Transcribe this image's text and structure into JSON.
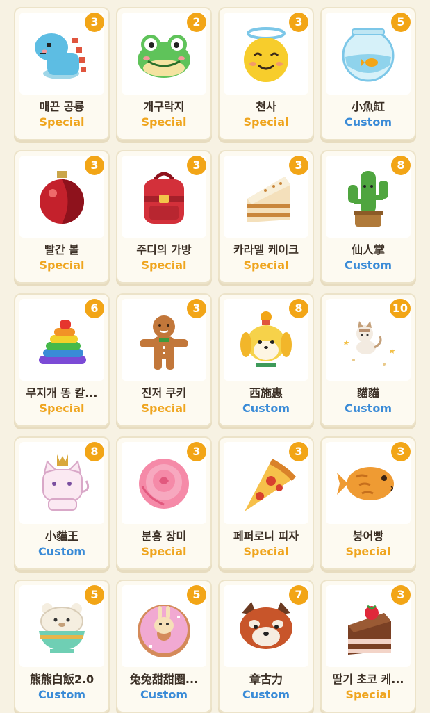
{
  "colors": {
    "special": "#efa51f",
    "custom": "#3a8bd7",
    "badge": "#f2a516"
  },
  "items": [
    {
      "name": "매끈 공룡",
      "tag": "Special",
      "count": "3",
      "icon": "dinosaur-icon"
    },
    {
      "name": "개구락지",
      "tag": "Special",
      "count": "2",
      "icon": "frog-icon"
    },
    {
      "name": "천사",
      "tag": "Special",
      "count": "3",
      "icon": "angel-face-icon"
    },
    {
      "name": "小魚缸",
      "tag": "Custom",
      "count": "5",
      "icon": "fishbowl-icon"
    },
    {
      "name": "빨간 볼",
      "tag": "Special",
      "count": "3",
      "icon": "red-ornament-icon"
    },
    {
      "name": "주디의 가방",
      "tag": "Special",
      "count": "3",
      "icon": "red-backpack-icon"
    },
    {
      "name": "카라멜 케이크",
      "tag": "Special",
      "count": "3",
      "icon": "caramel-cake-icon"
    },
    {
      "name": "仙人掌",
      "tag": "Custom",
      "count": "8",
      "icon": "cactus-icon"
    },
    {
      "name": "무지개 똥 칼...",
      "tag": "Special",
      "count": "6",
      "icon": "rainbow-poop-icon"
    },
    {
      "name": "진저 쿠키",
      "tag": "Special",
      "count": "3",
      "icon": "gingerbread-icon"
    },
    {
      "name": "西施惠",
      "tag": "Custom",
      "count": "8",
      "icon": "isabelle-icon"
    },
    {
      "name": "貓貓",
      "tag": "Custom",
      "count": "10",
      "icon": "cat-icon"
    },
    {
      "name": "小貓王",
      "tag": "Custom",
      "count": "8",
      "icon": "cat-king-icon"
    },
    {
      "name": "분홍 장미",
      "tag": "Special",
      "count": "3",
      "icon": "pink-rose-icon"
    },
    {
      "name": "페퍼로니 피자",
      "tag": "Special",
      "count": "3",
      "icon": "pizza-icon"
    },
    {
      "name": "붕어빵",
      "tag": "Special",
      "count": "3",
      "icon": "taiyaki-icon"
    },
    {
      "name": "熊熊白飯2.0",
      "tag": "Custom",
      "count": "5",
      "icon": "bear-rice-bowl-icon"
    },
    {
      "name": "兔兔甜甜圈...",
      "tag": "Custom",
      "count": "5",
      "icon": "bunny-donut-icon"
    },
    {
      "name": "章古力",
      "tag": "Custom",
      "count": "7",
      "icon": "red-panda-icon"
    },
    {
      "name": "딸기 초코 케...",
      "tag": "Special",
      "count": "3",
      "icon": "strawberry-choco-cake-icon"
    }
  ]
}
